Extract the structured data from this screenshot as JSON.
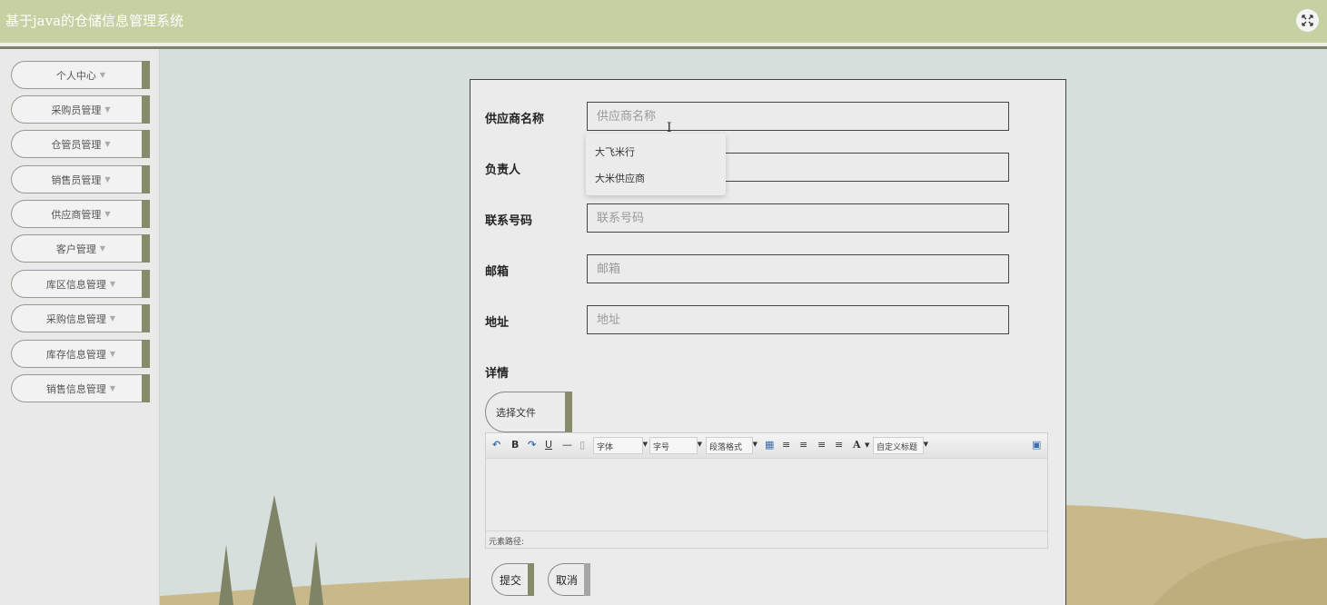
{
  "header": {
    "title": "基于java的仓储信息管理系统",
    "fullscreen_icon": "expand-arrows-icon"
  },
  "sidebar": {
    "items": [
      {
        "label": "个人中心"
      },
      {
        "label": "采购员管理"
      },
      {
        "label": "仓管员管理"
      },
      {
        "label": "销售员管理"
      },
      {
        "label": "供应商管理"
      },
      {
        "label": "客户管理"
      },
      {
        "label": "库区信息管理"
      },
      {
        "label": "采购信息管理"
      },
      {
        "label": "库存信息管理"
      },
      {
        "label": "销售信息管理"
      }
    ]
  },
  "form": {
    "fields": [
      {
        "label": "供应商名称",
        "placeholder": "供应商名称",
        "value": ""
      },
      {
        "label": "负责人",
        "placeholder": "",
        "value": ""
      },
      {
        "label": "联系号码",
        "placeholder": "联系号码",
        "value": ""
      },
      {
        "label": "邮箱",
        "placeholder": "邮箱",
        "value": ""
      },
      {
        "label": "地址",
        "placeholder": "地址",
        "value": ""
      }
    ],
    "suggestions": [
      "大飞米行",
      "大米供应商"
    ],
    "detail_label": "详情",
    "file_button": "选择文件",
    "submit_label": "提交",
    "cancel_label": "取消"
  },
  "editor": {
    "font_select": "字体",
    "size_select": "字号",
    "paragraph_select": "段落格式",
    "custom_title_select": "自定义标题",
    "bold": "B",
    "underline": "U",
    "hr": "—",
    "font_color": "A",
    "element_path_label": "元素路径:"
  },
  "colors": {
    "header_bg": "#c5d0a3",
    "accent": "#878b6a",
    "page_bg": "#d6dfdc"
  }
}
